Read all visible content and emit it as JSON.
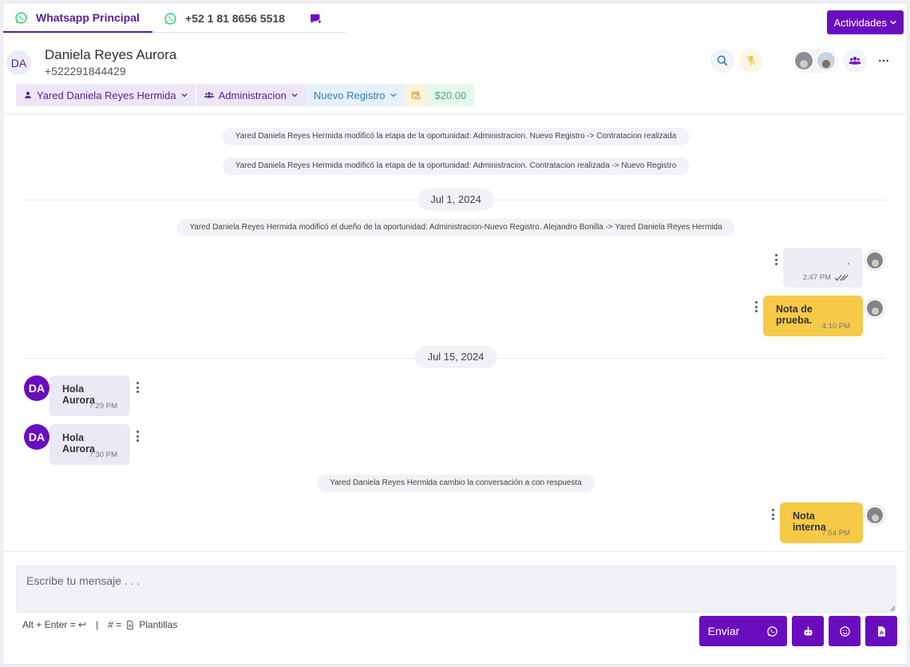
{
  "tabs": [
    {
      "label": "Whatsapp Principal",
      "active": true,
      "icon": "whatsapp-icon"
    },
    {
      "label": "+52 1 81 8656 5518",
      "active": false,
      "icon": "whatsapp-icon"
    }
  ],
  "actividades_label": "Actividades",
  "contact": {
    "initials": "DA",
    "name": "Daniela Reyes Aurora",
    "phone": "+522291844429"
  },
  "pills": {
    "owner": "Yared Daniela Reyes Hermida",
    "pipeline": "Administracion",
    "stage": "Nuevo Registro",
    "amount": "$20.00"
  },
  "messages": {
    "log1": "Yared Daniela Reyes Hermida modificó la etapa de la oportunidad: Administracion. Nuevo Registro -> Contratacion realizada",
    "log2": "Yared Daniela Reyes Hermida modificó la etapa de la oportunidad: Administracion. Contratacion realizada -> Nuevo Registro",
    "date1": "Jul 1, 2024",
    "log3": "Yared Daniela Reyes Hermida modificó el dueño de la oportunidad: Administracion-Nuevo Registro. Alejandro Bonilla -> Yared Daniela Reyes Hermida",
    "out1": {
      "text": ".",
      "time": "2:47 PM"
    },
    "note1": {
      "text": "Nota de prueba.",
      "time": "4:10 PM"
    },
    "date2": "Jul 15, 2024",
    "in1": {
      "text": "Hola Aurora",
      "time": "7:29 PM"
    },
    "in2": {
      "text": "Hola Aurora",
      "time": "7:30 PM"
    },
    "log4": "Yared Daniela Reyes Hermida cambio la conversación a con respuesta",
    "note2": {
      "text": "Nota interna",
      "time": "7:54 PM"
    }
  },
  "composer": {
    "placeholder": "Escribe tu mensaje . . .",
    "hint_send": "Alt + Enter = ↩",
    "hint_sep": "|",
    "hint_templates_prefix": "# =",
    "hint_templates": "Plantillas"
  },
  "send_label": "Enviar",
  "colors": {
    "primary": "#6a0dbf",
    "note": "#f6c947",
    "whatsapp": "#25d366"
  }
}
